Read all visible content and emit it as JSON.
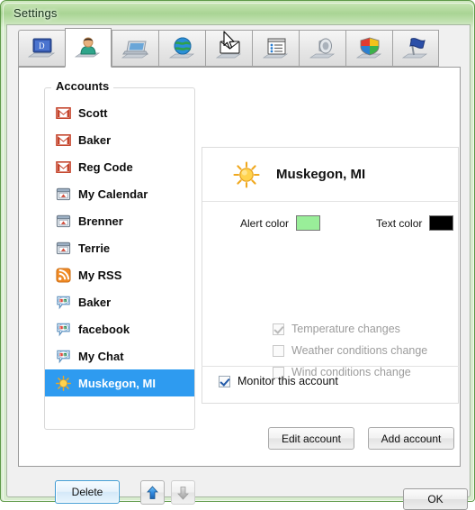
{
  "window": {
    "title": "Settings",
    "accent_green": "#a9d494",
    "frame_border": "#5f9a4a"
  },
  "tabs": [
    {
      "icon": "computer-monitor-icon",
      "active": false,
      "name": "tab-general"
    },
    {
      "icon": "person-user-icon",
      "active": true,
      "name": "tab-accounts"
    },
    {
      "icon": "laptop-icon",
      "active": false,
      "name": "tab-display"
    },
    {
      "icon": "globe-internet-icon",
      "active": false,
      "name": "tab-network"
    },
    {
      "icon": "envelope-mail-icon",
      "active": false,
      "name": "tab-mail"
    },
    {
      "icon": "notes-list-icon",
      "active": false,
      "name": "tab-notes"
    },
    {
      "icon": "speaker-sound-icon",
      "active": false,
      "name": "tab-sounds"
    },
    {
      "icon": "shield-security-icon",
      "active": false,
      "name": "tab-security"
    },
    {
      "icon": "flag-icon",
      "active": false,
      "name": "tab-advanced"
    }
  ],
  "accounts_group": {
    "legend": "Accounts",
    "selection_color": "#2e9bf0",
    "items": [
      {
        "label": "Scott",
        "icon": "gmail-icon",
        "selected": false
      },
      {
        "label": "Baker",
        "icon": "gmail-icon",
        "selected": false
      },
      {
        "label": "Reg Code",
        "icon": "gmail-icon",
        "selected": false
      },
      {
        "label": "My Calendar",
        "icon": "calendar-icon",
        "selected": false
      },
      {
        "label": "Brenner",
        "icon": "calendar-icon",
        "selected": false
      },
      {
        "label": "Terrie",
        "icon": "calendar-icon",
        "selected": false
      },
      {
        "label": "My RSS",
        "icon": "rss-icon",
        "selected": false
      },
      {
        "label": "Baker",
        "icon": "chat-icon",
        "selected": false
      },
      {
        "label": "facebook",
        "icon": "chat-icon",
        "selected": false
      },
      {
        "label": "My Chat",
        "icon": "chat-icon",
        "selected": false
      },
      {
        "label": "Muskegon, MI",
        "icon": "sun-icon",
        "selected": true
      }
    ]
  },
  "list_toolbar": {
    "delete_label": "Delete",
    "move_up_enabled": true,
    "move_down_enabled": false,
    "move_up_color": "#2e86de",
    "move_down_color": "#b9b9b9"
  },
  "detail": {
    "title": "Muskegon, MI",
    "icon": "sun-icon",
    "alert_color_label": "Alert color",
    "alert_color_value": "#99ee99",
    "text_color_label": "Text color",
    "text_color_value": "#000000",
    "options": [
      {
        "label": "Temperature changes",
        "checked": true,
        "enabled": false
      },
      {
        "label": "Weather conditions change",
        "checked": false,
        "enabled": false
      },
      {
        "label": "Wind conditions change",
        "checked": false,
        "enabled": false
      }
    ],
    "monitor_label": "Monitor this account",
    "monitor_checked": true,
    "edit_account_label": "Edit account",
    "add_account_label": "Add account"
  },
  "footer": {
    "ok_label": "OK"
  }
}
